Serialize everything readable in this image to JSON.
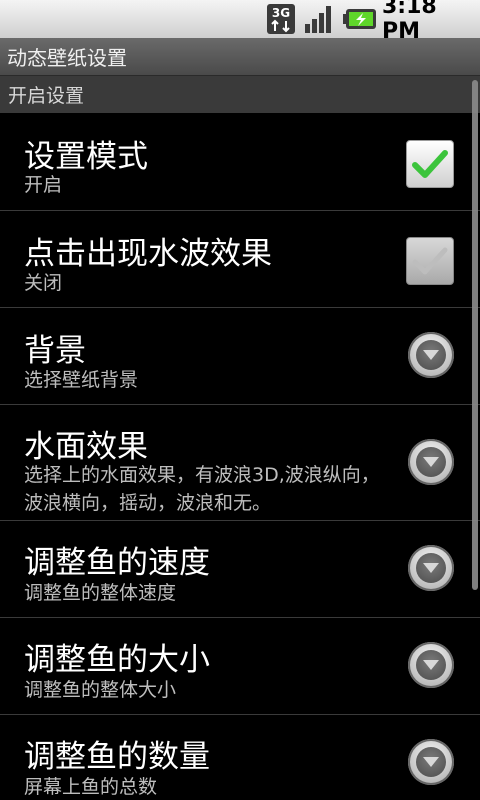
{
  "status_bar": {
    "network_label": "3G",
    "time": "3:18 PM",
    "icons": [
      "3g-data-icon",
      "signal-strength-icon",
      "battery-charging-icon"
    ]
  },
  "title_bar": {
    "title": "动态壁纸设置"
  },
  "category": {
    "label": "开启设置"
  },
  "preferences": [
    {
      "title": "设置模式",
      "summary": "开启",
      "control": "checkbox",
      "checked": true,
      "enabled": true
    },
    {
      "title": "点击出现水波效果",
      "summary": "关闭",
      "control": "checkbox",
      "checked": true,
      "enabled": false
    },
    {
      "title": "背景",
      "summary": "选择壁纸背景",
      "control": "dropdown-arrow"
    },
    {
      "title": "水面效果",
      "summary": "选择上的水面效果，有波浪3D,波浪纵向，波浪横向，摇动，波浪和无。",
      "control": "dropdown-arrow"
    },
    {
      "title": "调整鱼的速度",
      "summary": "调整鱼的整体速度",
      "control": "dropdown-arrow"
    },
    {
      "title": "调整鱼的大小",
      "summary": "调整鱼的整体大小",
      "control": "dropdown-arrow"
    },
    {
      "title": "调整鱼的数量",
      "summary": "屏幕上鱼的总数",
      "control": "dropdown-arrow"
    }
  ],
  "colors": {
    "check_green": "#3cc43c",
    "check_disabled": "#bdbdbd",
    "background": "#000000",
    "divider": "#3a3a3a"
  }
}
